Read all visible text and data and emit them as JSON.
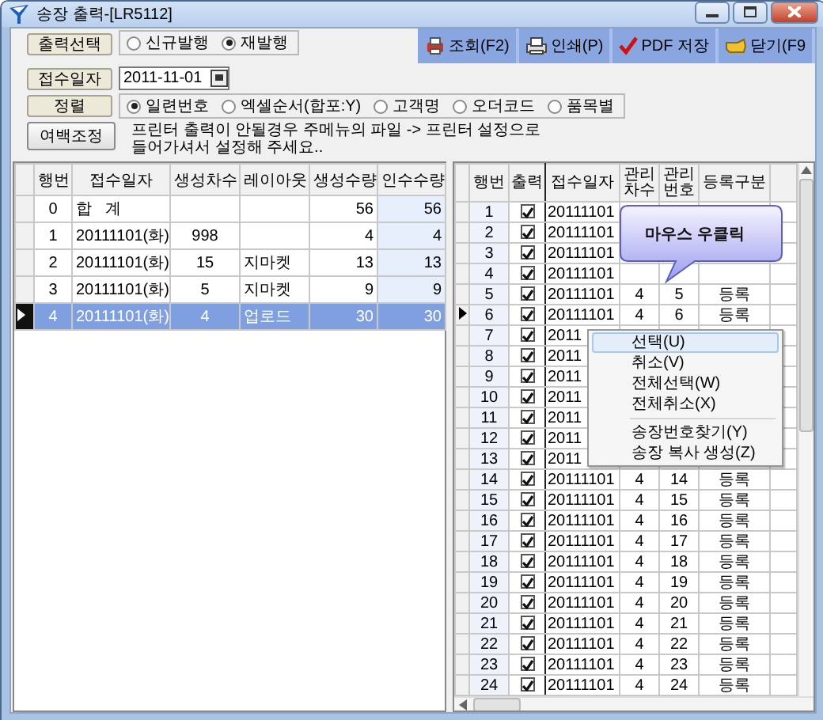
{
  "window": {
    "title": "송장 출력-[LR5112]"
  },
  "output_select": {
    "label": "출력선택",
    "options": [
      {
        "label": "신규발행",
        "selected": false
      },
      {
        "label": "재발행",
        "selected": true
      }
    ]
  },
  "receipt_date": {
    "label": "접수일자",
    "value": "2011-11-01"
  },
  "sort": {
    "label": "정렬",
    "options": [
      {
        "label": "일련번호",
        "selected": true
      },
      {
        "label": "엑셀순서(합포:Y)",
        "selected": false
      },
      {
        "label": "고객명",
        "selected": false
      },
      {
        "label": "오더코드",
        "selected": false
      },
      {
        "label": "품목별",
        "selected": false
      }
    ]
  },
  "margin_button": "여백조정",
  "notice": "프린터 출력이 안될경우 주메뉴의 파일 -> 프린터 설정으로 들어가셔서 설정해 주세요..",
  "toolbar": [
    {
      "kind": "search",
      "label": "조회(F2)"
    },
    {
      "kind": "print",
      "label": "인쇄(P)"
    },
    {
      "kind": "pdf",
      "label": "PDF 저장"
    },
    {
      "kind": "close",
      "label": "닫기(F9"
    }
  ],
  "left_table": {
    "columns": [
      "행번",
      "접수일자",
      "생성차수",
      "레이아웃",
      "생성수량",
      "인수수량"
    ],
    "rows": [
      {
        "cells": [
          "0",
          "합   계",
          "",
          "",
          "56",
          "56"
        ],
        "selected": false
      },
      {
        "cells": [
          "1",
          "20111101(화)",
          "998",
          "",
          "4",
          "4"
        ],
        "selected": false
      },
      {
        "cells": [
          "2",
          "20111101(화)",
          "15",
          "지마켓",
          "13",
          "13"
        ],
        "selected": false
      },
      {
        "cells": [
          "3",
          "20111101(화)",
          "5",
          "지마켓",
          "9",
          "9"
        ],
        "selected": false
      },
      {
        "cells": [
          "4",
          "20111101(화)",
          "4",
          "업로드",
          "30",
          "30"
        ],
        "selected": true
      }
    ]
  },
  "right_table": {
    "columns": [
      "행번",
      "출력",
      "접수일자",
      "관리 차수",
      "관리 번호",
      "등록구분"
    ],
    "rows": [
      {
        "cells": [
          "1",
          "",
          "20111101"
        ],
        "checked": true,
        "selected": false
      },
      {
        "cells": [
          "2",
          "",
          "20111101"
        ],
        "checked": true,
        "selected": false
      },
      {
        "cells": [
          "3",
          "",
          "20111101"
        ],
        "checked": true,
        "selected": false
      },
      {
        "cells": [
          "4",
          "",
          "20111101"
        ],
        "checked": true,
        "selected": false
      },
      {
        "cells": [
          "5",
          "",
          "20111101",
          "4",
          "5",
          "등록"
        ],
        "checked": true,
        "selected": false
      },
      {
        "cells": [
          "6",
          "",
          "20111101",
          "4",
          "6",
          "등록"
        ],
        "checked": true,
        "selected": true
      },
      {
        "cells": [
          "7",
          "",
          "2011"
        ],
        "checked": true,
        "selected": false
      },
      {
        "cells": [
          "8",
          "",
          "2011"
        ],
        "checked": true,
        "selected": false
      },
      {
        "cells": [
          "9",
          "",
          "2011"
        ],
        "checked": true,
        "selected": false
      },
      {
        "cells": [
          "10",
          "",
          "2011"
        ],
        "checked": true,
        "selected": false
      },
      {
        "cells": [
          "11",
          "",
          "2011"
        ],
        "checked": true,
        "selected": false
      },
      {
        "cells": [
          "12",
          "",
          "2011"
        ],
        "checked": true,
        "selected": false
      },
      {
        "cells": [
          "13",
          "",
          "2011"
        ],
        "checked": true,
        "selected": false
      },
      {
        "cells": [
          "14",
          "",
          "20111101",
          "4",
          "14",
          "등록"
        ],
        "checked": true,
        "selected": false
      },
      {
        "cells": [
          "15",
          "",
          "20111101",
          "4",
          "15",
          "등록"
        ],
        "checked": true,
        "selected": false
      },
      {
        "cells": [
          "16",
          "",
          "20111101",
          "4",
          "16",
          "등록"
        ],
        "checked": true,
        "selected": false
      },
      {
        "cells": [
          "17",
          "",
          "20111101",
          "4",
          "17",
          "등록"
        ],
        "checked": true,
        "selected": false
      },
      {
        "cells": [
          "18",
          "",
          "20111101",
          "4",
          "18",
          "등록"
        ],
        "checked": true,
        "selected": false
      },
      {
        "cells": [
          "19",
          "",
          "20111101",
          "4",
          "19",
          "등록"
        ],
        "checked": true,
        "selected": false
      },
      {
        "cells": [
          "20",
          "",
          "20111101",
          "4",
          "20",
          "등록"
        ],
        "checked": true,
        "selected": false
      },
      {
        "cells": [
          "21",
          "",
          "20111101",
          "4",
          "21",
          "등록"
        ],
        "checked": true,
        "selected": false
      },
      {
        "cells": [
          "22",
          "",
          "20111101",
          "4",
          "22",
          "등록"
        ],
        "checked": true,
        "selected": false
      },
      {
        "cells": [
          "23",
          "",
          "20111101",
          "4",
          "23",
          "등록"
        ],
        "checked": true,
        "selected": false
      },
      {
        "cells": [
          "24",
          "",
          "20111101",
          "4",
          "24",
          "등록"
        ],
        "checked": true,
        "selected": false
      }
    ]
  },
  "callout": "마우스 우클릭",
  "context_menu": {
    "groups": [
      [
        {
          "label": "선택(U)",
          "selected": true
        },
        {
          "label": "취소(V)",
          "selected": false
        },
        {
          "label": "전체선택(W)",
          "selected": false
        },
        {
          "label": "전체취소(X)",
          "selected": false
        }
      ],
      [
        {
          "label": "송장번호찾기(Y)",
          "selected": false
        },
        {
          "label": "송장 복사 생성(Z)",
          "selected": false
        }
      ]
    ]
  }
}
